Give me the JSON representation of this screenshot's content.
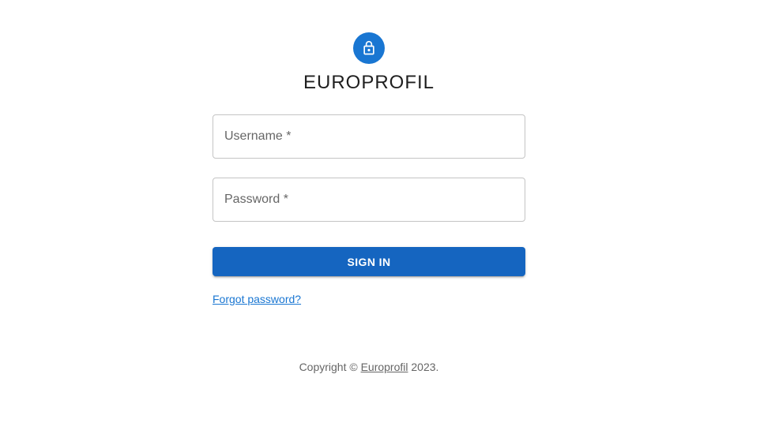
{
  "header": {
    "icon": "lock-icon",
    "title": "EUROPROFIL",
    "accent_color": "#1976d2"
  },
  "form": {
    "username_label": "Username *",
    "username_value": "",
    "password_label": "Password *",
    "password_value": "",
    "submit_label": "SIGN IN",
    "submit_color": "#1565c0",
    "forgot_label": "Forgot password?"
  },
  "footer": {
    "prefix": "Copyright © ",
    "link_label": "Europrofil",
    "suffix": " 2023."
  }
}
